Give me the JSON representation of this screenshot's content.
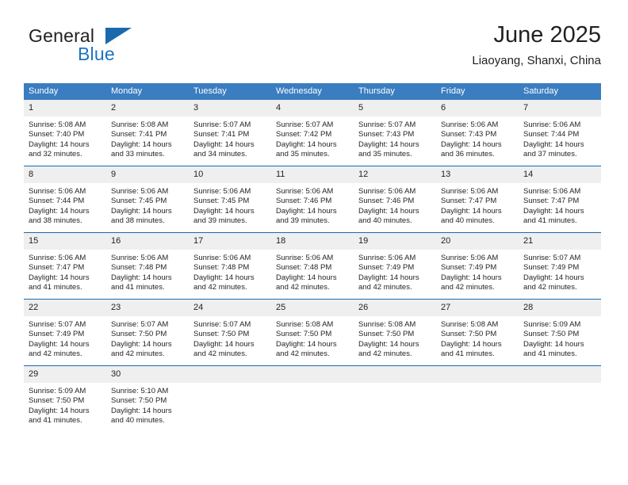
{
  "brand": {
    "name_part1": "General",
    "name_part2": "Blue",
    "logo_icon": "triangle-flag-icon"
  },
  "header": {
    "title": "June 2025",
    "subtitle": "Liaoyang, Shanxi, China"
  },
  "calendar": {
    "weekday_headers": [
      "Sunday",
      "Monday",
      "Tuesday",
      "Wednesday",
      "Thursday",
      "Friday",
      "Saturday"
    ],
    "accent_color": "#3a7dc0",
    "row_divider_color": "#1b69ad",
    "daynum_background": "#efefef",
    "weeks": [
      [
        {
          "day": "1",
          "sunrise": "Sunrise: 5:08 AM",
          "sunset": "Sunset: 7:40 PM",
          "daylight_line1": "Daylight: 14 hours",
          "daylight_line2": "and 32 minutes."
        },
        {
          "day": "2",
          "sunrise": "Sunrise: 5:08 AM",
          "sunset": "Sunset: 7:41 PM",
          "daylight_line1": "Daylight: 14 hours",
          "daylight_line2": "and 33 minutes."
        },
        {
          "day": "3",
          "sunrise": "Sunrise: 5:07 AM",
          "sunset": "Sunset: 7:41 PM",
          "daylight_line1": "Daylight: 14 hours",
          "daylight_line2": "and 34 minutes."
        },
        {
          "day": "4",
          "sunrise": "Sunrise: 5:07 AM",
          "sunset": "Sunset: 7:42 PM",
          "daylight_line1": "Daylight: 14 hours",
          "daylight_line2": "and 35 minutes."
        },
        {
          "day": "5",
          "sunrise": "Sunrise: 5:07 AM",
          "sunset": "Sunset: 7:43 PM",
          "daylight_line1": "Daylight: 14 hours",
          "daylight_line2": "and 35 minutes."
        },
        {
          "day": "6",
          "sunrise": "Sunrise: 5:06 AM",
          "sunset": "Sunset: 7:43 PM",
          "daylight_line1": "Daylight: 14 hours",
          "daylight_line2": "and 36 minutes."
        },
        {
          "day": "7",
          "sunrise": "Sunrise: 5:06 AM",
          "sunset": "Sunset: 7:44 PM",
          "daylight_line1": "Daylight: 14 hours",
          "daylight_line2": "and 37 minutes."
        }
      ],
      [
        {
          "day": "8",
          "sunrise": "Sunrise: 5:06 AM",
          "sunset": "Sunset: 7:44 PM",
          "daylight_line1": "Daylight: 14 hours",
          "daylight_line2": "and 38 minutes."
        },
        {
          "day": "9",
          "sunrise": "Sunrise: 5:06 AM",
          "sunset": "Sunset: 7:45 PM",
          "daylight_line1": "Daylight: 14 hours",
          "daylight_line2": "and 38 minutes."
        },
        {
          "day": "10",
          "sunrise": "Sunrise: 5:06 AM",
          "sunset": "Sunset: 7:45 PM",
          "daylight_line1": "Daylight: 14 hours",
          "daylight_line2": "and 39 minutes."
        },
        {
          "day": "11",
          "sunrise": "Sunrise: 5:06 AM",
          "sunset": "Sunset: 7:46 PM",
          "daylight_line1": "Daylight: 14 hours",
          "daylight_line2": "and 39 minutes."
        },
        {
          "day": "12",
          "sunrise": "Sunrise: 5:06 AM",
          "sunset": "Sunset: 7:46 PM",
          "daylight_line1": "Daylight: 14 hours",
          "daylight_line2": "and 40 minutes."
        },
        {
          "day": "13",
          "sunrise": "Sunrise: 5:06 AM",
          "sunset": "Sunset: 7:47 PM",
          "daylight_line1": "Daylight: 14 hours",
          "daylight_line2": "and 40 minutes."
        },
        {
          "day": "14",
          "sunrise": "Sunrise: 5:06 AM",
          "sunset": "Sunset: 7:47 PM",
          "daylight_line1": "Daylight: 14 hours",
          "daylight_line2": "and 41 minutes."
        }
      ],
      [
        {
          "day": "15",
          "sunrise": "Sunrise: 5:06 AM",
          "sunset": "Sunset: 7:47 PM",
          "daylight_line1": "Daylight: 14 hours",
          "daylight_line2": "and 41 minutes."
        },
        {
          "day": "16",
          "sunrise": "Sunrise: 5:06 AM",
          "sunset": "Sunset: 7:48 PM",
          "daylight_line1": "Daylight: 14 hours",
          "daylight_line2": "and 41 minutes."
        },
        {
          "day": "17",
          "sunrise": "Sunrise: 5:06 AM",
          "sunset": "Sunset: 7:48 PM",
          "daylight_line1": "Daylight: 14 hours",
          "daylight_line2": "and 42 minutes."
        },
        {
          "day": "18",
          "sunrise": "Sunrise: 5:06 AM",
          "sunset": "Sunset: 7:48 PM",
          "daylight_line1": "Daylight: 14 hours",
          "daylight_line2": "and 42 minutes."
        },
        {
          "day": "19",
          "sunrise": "Sunrise: 5:06 AM",
          "sunset": "Sunset: 7:49 PM",
          "daylight_line1": "Daylight: 14 hours",
          "daylight_line2": "and 42 minutes."
        },
        {
          "day": "20",
          "sunrise": "Sunrise: 5:06 AM",
          "sunset": "Sunset: 7:49 PM",
          "daylight_line1": "Daylight: 14 hours",
          "daylight_line2": "and 42 minutes."
        },
        {
          "day": "21",
          "sunrise": "Sunrise: 5:07 AM",
          "sunset": "Sunset: 7:49 PM",
          "daylight_line1": "Daylight: 14 hours",
          "daylight_line2": "and 42 minutes."
        }
      ],
      [
        {
          "day": "22",
          "sunrise": "Sunrise: 5:07 AM",
          "sunset": "Sunset: 7:49 PM",
          "daylight_line1": "Daylight: 14 hours",
          "daylight_line2": "and 42 minutes."
        },
        {
          "day": "23",
          "sunrise": "Sunrise: 5:07 AM",
          "sunset": "Sunset: 7:50 PM",
          "daylight_line1": "Daylight: 14 hours",
          "daylight_line2": "and 42 minutes."
        },
        {
          "day": "24",
          "sunrise": "Sunrise: 5:07 AM",
          "sunset": "Sunset: 7:50 PM",
          "daylight_line1": "Daylight: 14 hours",
          "daylight_line2": "and 42 minutes."
        },
        {
          "day": "25",
          "sunrise": "Sunrise: 5:08 AM",
          "sunset": "Sunset: 7:50 PM",
          "daylight_line1": "Daylight: 14 hours",
          "daylight_line2": "and 42 minutes."
        },
        {
          "day": "26",
          "sunrise": "Sunrise: 5:08 AM",
          "sunset": "Sunset: 7:50 PM",
          "daylight_line1": "Daylight: 14 hours",
          "daylight_line2": "and 42 minutes."
        },
        {
          "day": "27",
          "sunrise": "Sunrise: 5:08 AM",
          "sunset": "Sunset: 7:50 PM",
          "daylight_line1": "Daylight: 14 hours",
          "daylight_line2": "and 41 minutes."
        },
        {
          "day": "28",
          "sunrise": "Sunrise: 5:09 AM",
          "sunset": "Sunset: 7:50 PM",
          "daylight_line1": "Daylight: 14 hours",
          "daylight_line2": "and 41 minutes."
        }
      ],
      [
        {
          "day": "29",
          "sunrise": "Sunrise: 5:09 AM",
          "sunset": "Sunset: 7:50 PM",
          "daylight_line1": "Daylight: 14 hours",
          "daylight_line2": "and 41 minutes."
        },
        {
          "day": "30",
          "sunrise": "Sunrise: 5:10 AM",
          "sunset": "Sunset: 7:50 PM",
          "daylight_line1": "Daylight: 14 hours",
          "daylight_line2": "and 40 minutes."
        },
        {
          "day": "",
          "sunrise": "",
          "sunset": "",
          "daylight_line1": "",
          "daylight_line2": ""
        },
        {
          "day": "",
          "sunrise": "",
          "sunset": "",
          "daylight_line1": "",
          "daylight_line2": ""
        },
        {
          "day": "",
          "sunrise": "",
          "sunset": "",
          "daylight_line1": "",
          "daylight_line2": ""
        },
        {
          "day": "",
          "sunrise": "",
          "sunset": "",
          "daylight_line1": "",
          "daylight_line2": ""
        },
        {
          "day": "",
          "sunrise": "",
          "sunset": "",
          "daylight_line1": "",
          "daylight_line2": ""
        }
      ]
    ]
  }
}
